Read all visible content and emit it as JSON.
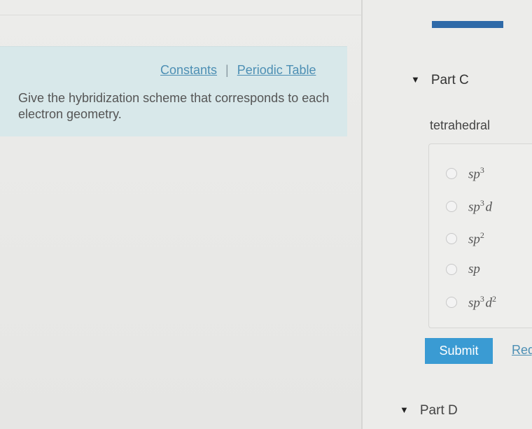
{
  "links": {
    "constants": "Constants",
    "separator": "|",
    "periodic_table": "Periodic Table"
  },
  "prompt": "Give the hybridization scheme that corresponds to each electron geometry.",
  "part_c": {
    "title": "Part C",
    "question": "tetrahedral"
  },
  "options": [
    {
      "base": "sp",
      "sup1": "3",
      "mid": "",
      "sup2": ""
    },
    {
      "base": "sp",
      "sup1": "3",
      "mid": "d",
      "sup2": ""
    },
    {
      "base": "sp",
      "sup1": "2",
      "mid": "",
      "sup2": ""
    },
    {
      "base": "sp",
      "sup1": "",
      "mid": "",
      "sup2": ""
    },
    {
      "base": "sp",
      "sup1": "3",
      "mid": "d",
      "sup2": "2"
    }
  ],
  "submit_label": "Submit",
  "request_label": "Req",
  "part_d": {
    "title": "Part D"
  },
  "colors": {
    "info_box": "#d8e8ea",
    "accent": "#3a9bd3",
    "link": "#4d8fb4",
    "top_bar": "#2f6aa8"
  }
}
